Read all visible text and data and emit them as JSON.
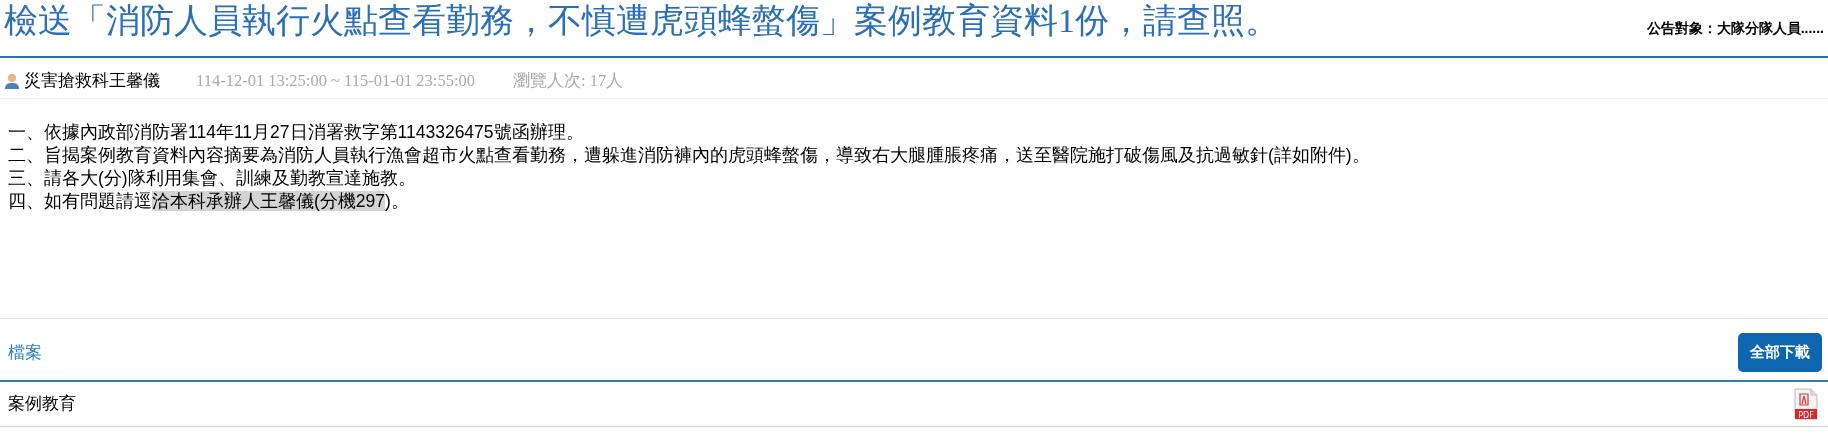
{
  "title": "檢送「消防人員執行火點查看勤務，不慎遭虎頭蜂螫傷」案例教育資料1份，請查照。",
  "audience": "公告對象：大隊分隊人員......",
  "meta": {
    "author": "災害搶救科王馨儀",
    "period": "114-12-01 13:25:00 ~ 115-01-01 23:55:00",
    "views": "瀏覽人次: 17人"
  },
  "body": [
    {
      "parts": [
        {
          "text": "一、依據內政部消防署114年11月27日消署救字第1143326475號函辦理。",
          "highlighted": false
        }
      ]
    },
    {
      "parts": [
        {
          "text": "二、旨揭案例教育資料內容摘要為消防人員執行漁會超市火點查看勤務，遭躲進消防褲內的虎頭蜂螫傷，導致右大腿腫脹疼痛，送至醫院施打破傷風及抗過敏針(詳如附件)。",
          "highlighted": false
        }
      ]
    },
    {
      "parts": [
        {
          "text": "三、請各大(分)隊利用集會、訓練及勤教宣達施教。",
          "highlighted": false
        }
      ]
    },
    {
      "parts": [
        {
          "text": "四、如有問題請逕",
          "highlighted": false
        },
        {
          "text": "洽本科承辦人王馨儀(分機297",
          "highlighted": true
        },
        {
          "text": ")。",
          "highlighted": false
        }
      ]
    }
  ],
  "files": {
    "heading": "檔案",
    "download_all": "全部下載",
    "items": [
      {
        "name": "案例教育",
        "kind": "pdf",
        "icon_label": "PDF"
      }
    ]
  }
}
